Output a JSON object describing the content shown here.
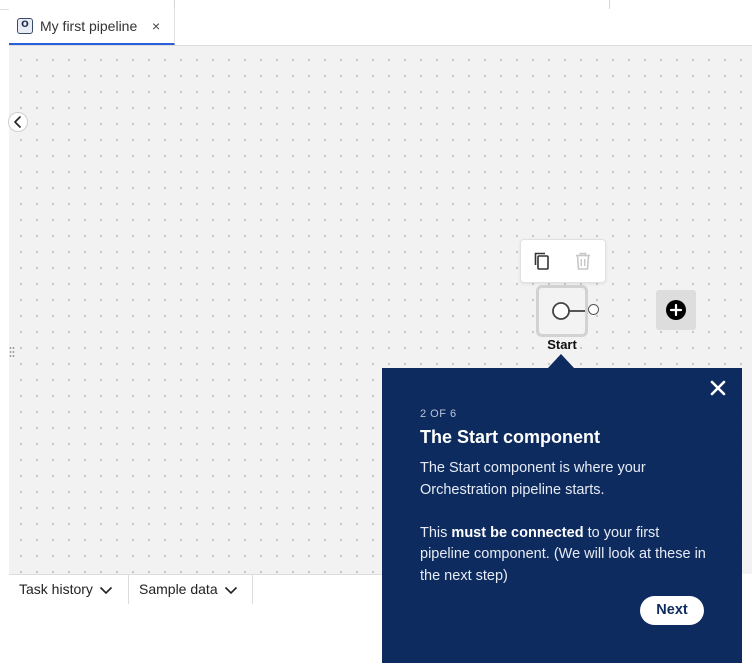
{
  "tab": {
    "icon_letter": "O",
    "label": "My first pipeline",
    "close_glyph": "×"
  },
  "canvas": {
    "start_node": {
      "label": "Start"
    },
    "toolbar": {
      "icons": [
        "copy-icon",
        "trash-icon"
      ]
    },
    "add_node_icon": "plus-circle-icon"
  },
  "bottom_tabs": [
    {
      "label": "Task history"
    },
    {
      "label": "Sample data"
    }
  ],
  "popover": {
    "step": "2 OF 6",
    "title": "The Start component",
    "paragraph1": "The Start component is where your Orchestration pipeline starts.",
    "paragraph2_prefix": "This ",
    "paragraph2_bold": "must be connected",
    "paragraph2_suffix": " to your first pipeline component. (We will look at these in the next step)",
    "next_label": "Next"
  },
  "colors": {
    "popover_bg": "#0d2b5e",
    "tab_accent": "#2b5fd9",
    "canvas_bg": "#f2f2f2"
  }
}
